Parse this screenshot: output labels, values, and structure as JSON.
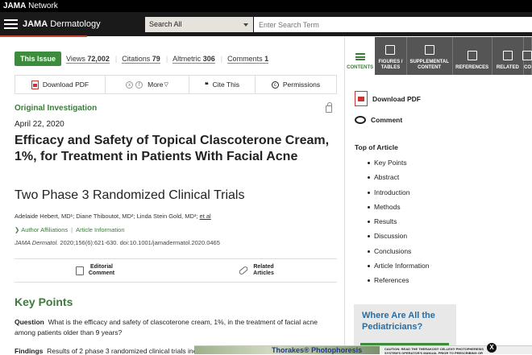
{
  "topbar": {
    "brand": "JAMA",
    "suffix": "Network"
  },
  "header": {
    "journal_bold": "JAMA",
    "journal_rest": "Dermatology",
    "search_scope": "Search All",
    "search_placeholder": "Enter Search Term"
  },
  "stats": {
    "badge": "This Issue",
    "views_label": "Views",
    "views": "72,002",
    "citations_label": "Citations",
    "citations": "79",
    "altmetric_label": "Altmetric",
    "altmetric": "306",
    "comments_label": "Comments",
    "comments": "1"
  },
  "toolbar": {
    "download_pdf": "Download PDF",
    "more": "More",
    "cite": "Cite This",
    "permissions": "Permissions"
  },
  "article": {
    "type": "Original Investigation",
    "date": "April 22, 2020",
    "title": "Efficacy and Safety of Topical Clascoterone Cream, 1%, for Treatment in Patients With Facial Acne",
    "subtitle": "Two Phase 3 Randomized Clinical Trials",
    "authors": "Adelaide Hebert, MD¹; Diane Thiboutot, MD²; Linda Stein Gold, MD³; ",
    "et_al": "et al",
    "author_affiliations": "Author Affiliations",
    "article_information": "Article Information",
    "journal_abbrev": "JAMA Dermatol.",
    "citation": " 2020;156(6):621-630. doi:10.1001/jamadermatol.2020.0465"
  },
  "bottombar": {
    "editorial": "Editorial\nComment",
    "related": "Related\nArticles"
  },
  "key_points": {
    "title": "Key Points",
    "question_label": "Question",
    "question": "What is the efficacy and safety of clascoterone cream, 1%, in the treatment of facial acne among patients older than 9 years?",
    "findings_label": "Findings",
    "findings": "Results of 2 phase 3 randomized clinical trials inc"
  },
  "tabs": [
    "CONTENTS",
    "FIGURES / TABLES",
    "SUPPLEMENTAL CONTENT",
    "REFERENCES",
    "RELATED",
    "CO"
  ],
  "sidebar": {
    "download_pdf": "Download PDF",
    "comment": "Comment",
    "toc_title": "Top of Article",
    "toc": [
      "Key Points",
      "Abstract",
      "Introduction",
      "Methods",
      "Results",
      "Discussion",
      "Conclusions",
      "Article Information",
      "References"
    ],
    "promo_title": "Where Are All the Pediatricians?"
  },
  "ad": {
    "brand": "Thorakes® Photophoresis",
    "fine_print": "CAUTION: READ THE THERAKOS® CELLEX® PHOTOPHERESIS SYSTEM'S OPERATOR'S MANUAL PRIOR TO PRESCRIBING OR DISPENSING THIS",
    "close": "X"
  },
  "colors": {
    "accent_green": "#3d8b3d",
    "link_blue": "#2a6d9e",
    "pdf_red": "#cc3333"
  }
}
